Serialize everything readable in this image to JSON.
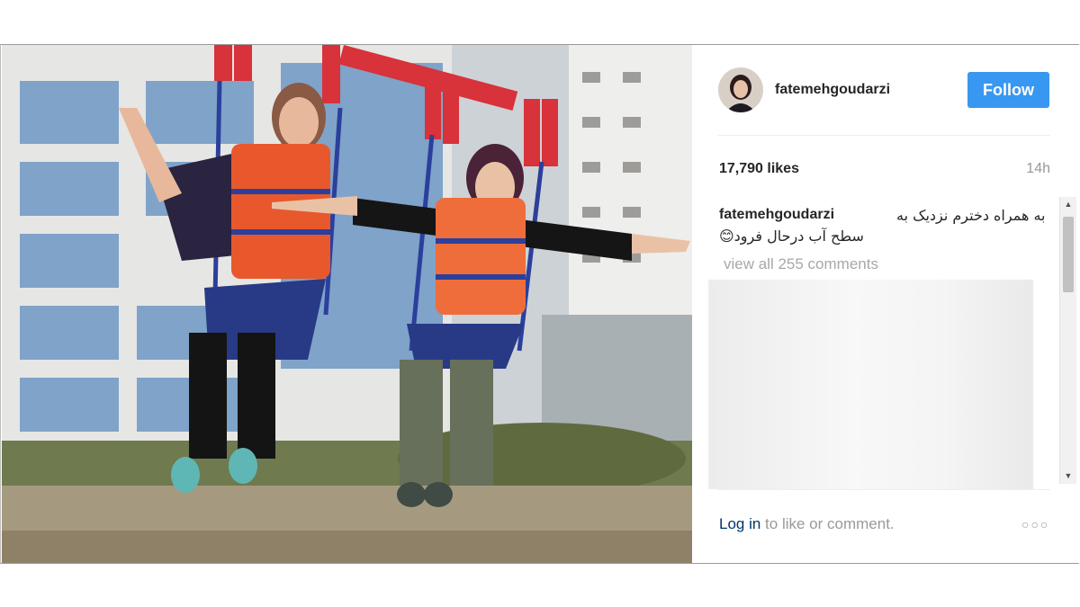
{
  "post": {
    "username": "fatemehgoudarzi",
    "follow_label": "Follow",
    "likes": "17,790 likes",
    "time_ago": "14h",
    "caption_user": "fatemehgoudarzi",
    "caption_line1": "به همراه دخترم نزدیک به",
    "caption_line2": "سطح آب درحال فرود😊",
    "view_all_comments": "view all 255 comments",
    "footer_login": "Log in",
    "footer_rest": " to like or comment.",
    "more_symbol": "○○○"
  },
  "colors": {
    "follow_bg": "#3897f0",
    "login_link": "#003569",
    "muted": "#999999"
  },
  "icons": {
    "avatar": "profile-avatar",
    "more": "more-options-icon",
    "scroll_up": "chevron-up-icon",
    "scroll_down": "chevron-down-icon"
  }
}
